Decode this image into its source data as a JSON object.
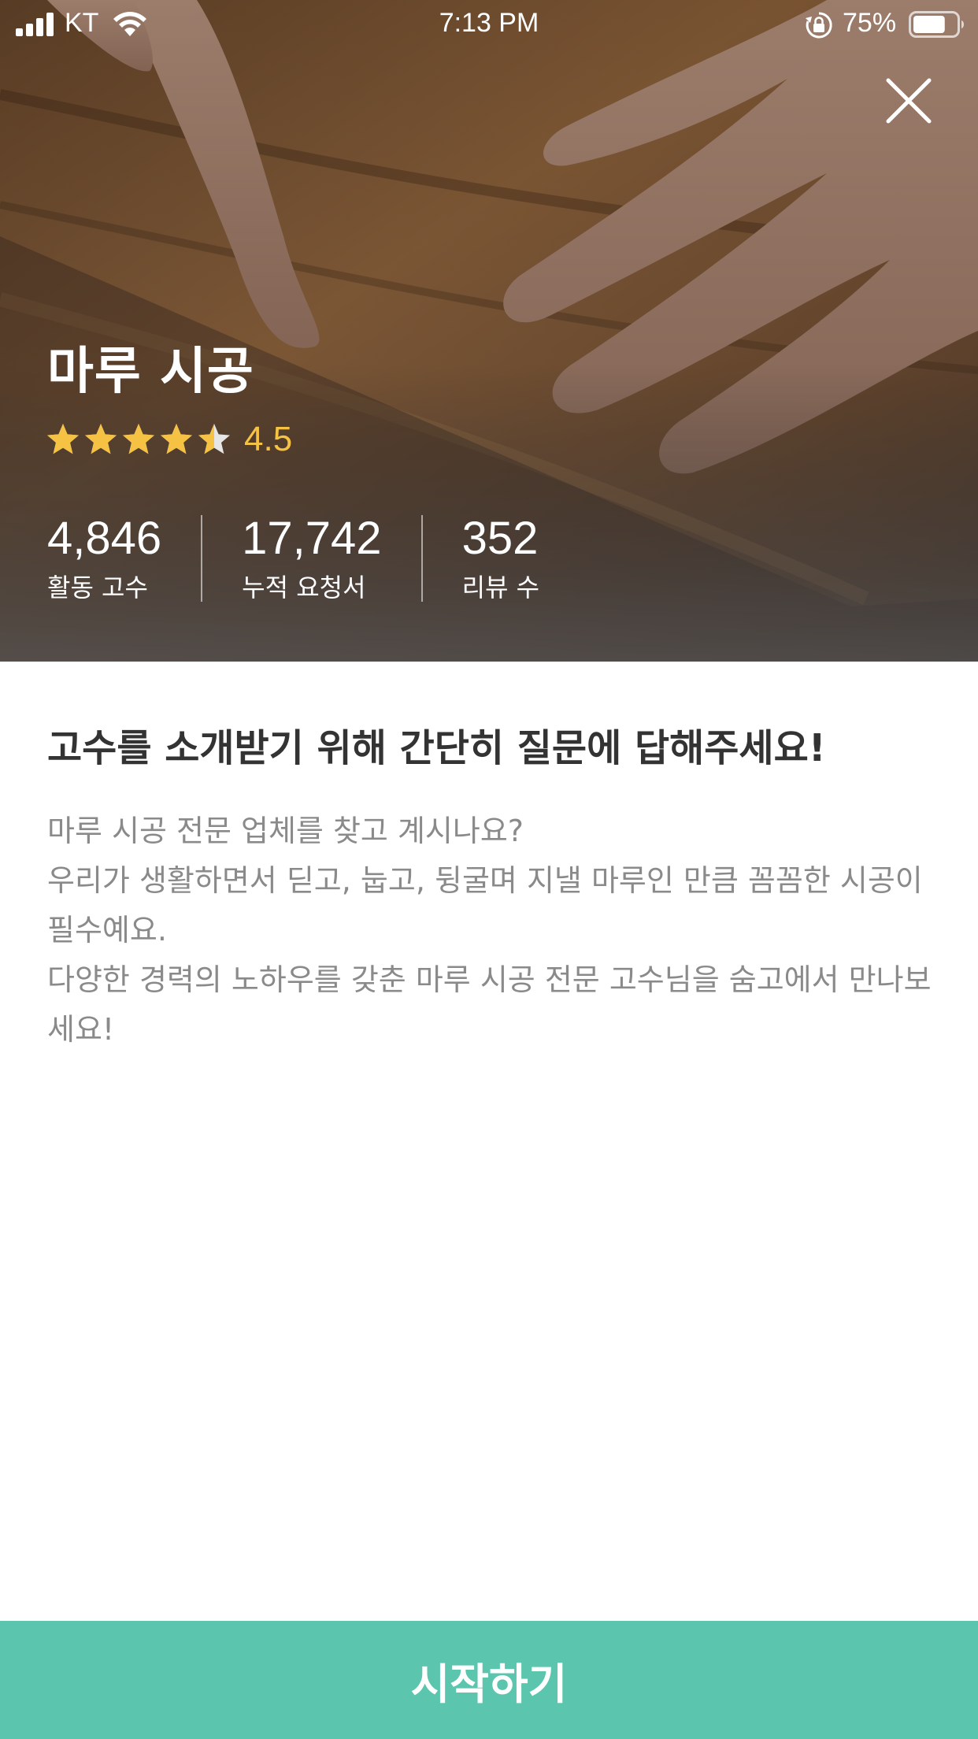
{
  "status_bar": {
    "carrier": "KT",
    "time": "7:13 PM",
    "battery_percent": "75%",
    "battery_level": 0.75,
    "icons": [
      "signal-icon",
      "wifi-icon",
      "rotation-lock-icon",
      "battery-icon"
    ]
  },
  "hero": {
    "close_icon": "close-icon",
    "title": "마루 시공",
    "rating": {
      "value": "4.5",
      "stars": 4.5,
      "max": 5,
      "color": "#f6c244"
    },
    "stats": [
      {
        "value": "4,846",
        "label": "활동 고수"
      },
      {
        "value": "17,742",
        "label": "누적 요청서"
      },
      {
        "value": "352",
        "label": "리뷰 수"
      }
    ]
  },
  "content": {
    "headline": "고수를 소개받기 위해 간단히 질문에 답해주세요!",
    "paragraphs": [
      "마루 시공 전문 업체를 찾고 계시나요?",
      "우리가 생활하면서 딛고, 눕고, 뒹굴며 지낼 마루인 만큼 꼼꼼한 시공이 필수예요.",
      "다양한 경력의 노하우를 갖춘 마루 시공 전문 고수님을 숨고에서 만나보세요!"
    ]
  },
  "footer": {
    "start_label": "시작하기",
    "accent_color": "#5bc5ad"
  }
}
